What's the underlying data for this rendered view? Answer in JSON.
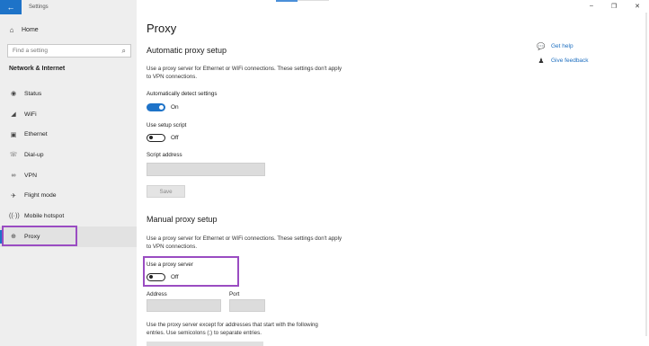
{
  "window": {
    "app_title": "Settings",
    "back_icon": "back-arrow-icon",
    "controls": [
      "–",
      "❐",
      "✕"
    ]
  },
  "sidebar": {
    "home_label": "Home",
    "search_placeholder": "Find a setting",
    "section_label": "Network & Internet",
    "items": [
      {
        "label": "Status",
        "icon": "status-icon"
      },
      {
        "label": "WiFi",
        "icon": "wifi-icon"
      },
      {
        "label": "Ethernet",
        "icon": "ethernet-icon"
      },
      {
        "label": "Dial-up",
        "icon": "dialup-icon"
      },
      {
        "label": "VPN",
        "icon": "vpn-icon"
      },
      {
        "label": "Flight mode",
        "icon": "flight-mode-icon"
      },
      {
        "label": "Mobile hotspot",
        "icon": "hotspot-icon"
      },
      {
        "label": "Proxy",
        "icon": "globe-icon",
        "selected": true
      }
    ]
  },
  "main": {
    "title": "Proxy",
    "automatic": {
      "heading": "Automatic proxy setup",
      "description": "Use a proxy server for Ethernet or WiFi connections. These settings don't apply to VPN connections.",
      "auto_detect_label": "Automatically detect settings",
      "auto_detect_state": "On",
      "setup_script_label": "Use setup script",
      "setup_script_state": "Off",
      "script_address_label": "Script address",
      "save_label": "Save"
    },
    "manual": {
      "heading": "Manual proxy setup",
      "description": "Use a proxy server for Ethernet or WiFi connections. These settings don't apply to VPN connections.",
      "use_proxy_label": "Use a proxy server",
      "use_proxy_state": "Off",
      "address_label": "Address",
      "port_label": "Port",
      "exceptions_text": "Use the proxy server except for addresses that start with the following entries. Use semicolons (;) to separate entries."
    }
  },
  "help": {
    "get_help": "Get help",
    "give_feedback": "Give feedback"
  },
  "colors": {
    "accent": "#1e73c8",
    "highlight": "#9a4cc2",
    "sidebar_bg": "#eeeeee"
  }
}
